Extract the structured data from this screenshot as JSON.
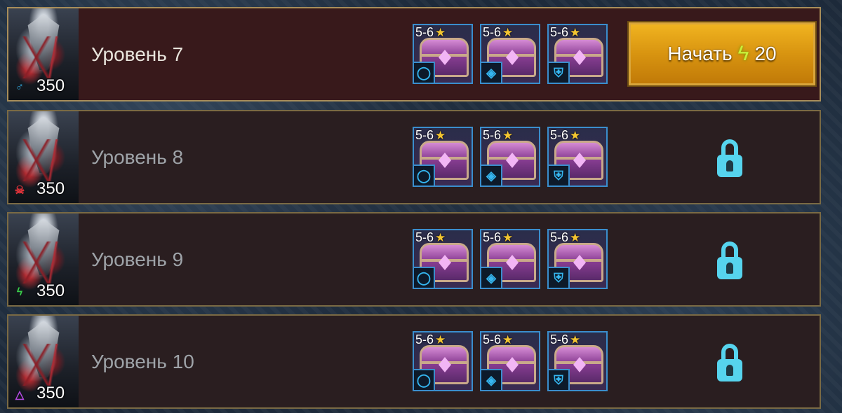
{
  "levels": [
    {
      "name": "Уровень 7",
      "power": "350",
      "affinity_icon": "magic-affinity-icon",
      "affinity_glyph": "♂",
      "affinity_color": "#35b6f0",
      "state": "active",
      "rewards": [
        {
          "rank": "5-6",
          "slot_icon": "ring-icon",
          "slot_glyph": "◯"
        },
        {
          "rank": "5-6",
          "slot_icon": "amulet-icon",
          "slot_glyph": "◈"
        },
        {
          "rank": "5-6",
          "slot_icon": "banner-icon",
          "slot_glyph": "⛨"
        }
      ],
      "action_label": "Начать",
      "action_cost": "20"
    },
    {
      "name": "Уровень 8",
      "power": "350",
      "affinity_icon": "force-affinity-icon",
      "affinity_glyph": "☠",
      "affinity_color": "#e0333a",
      "state": "locked",
      "rewards": [
        {
          "rank": "5-6",
          "slot_icon": "ring-icon",
          "slot_glyph": "◯"
        },
        {
          "rank": "5-6",
          "slot_icon": "amulet-icon",
          "slot_glyph": "◈"
        },
        {
          "rank": "5-6",
          "slot_icon": "banner-icon",
          "slot_glyph": "⛨"
        }
      ]
    },
    {
      "name": "Уровень 9",
      "power": "350",
      "affinity_icon": "spirit-affinity-icon",
      "affinity_glyph": "ϟ",
      "affinity_color": "#3acd4a",
      "state": "locked",
      "rewards": [
        {
          "rank": "5-6",
          "slot_icon": "ring-icon",
          "slot_glyph": "◯"
        },
        {
          "rank": "5-6",
          "slot_icon": "amulet-icon",
          "slot_glyph": "◈"
        },
        {
          "rank": "5-6",
          "slot_icon": "banner-icon",
          "slot_glyph": "⛨"
        }
      ]
    },
    {
      "name": "Уровень 10",
      "power": "350",
      "affinity_icon": "void-affinity-icon",
      "affinity_glyph": "△",
      "affinity_color": "#b84ae6",
      "state": "locked",
      "rewards": [
        {
          "rank": "5-6",
          "slot_icon": "ring-icon",
          "slot_glyph": "◯"
        },
        {
          "rank": "5-6",
          "slot_icon": "amulet-icon",
          "slot_glyph": "◈"
        },
        {
          "rank": "5-6",
          "slot_icon": "banner-icon",
          "slot_glyph": "⛨"
        }
      ]
    }
  ]
}
